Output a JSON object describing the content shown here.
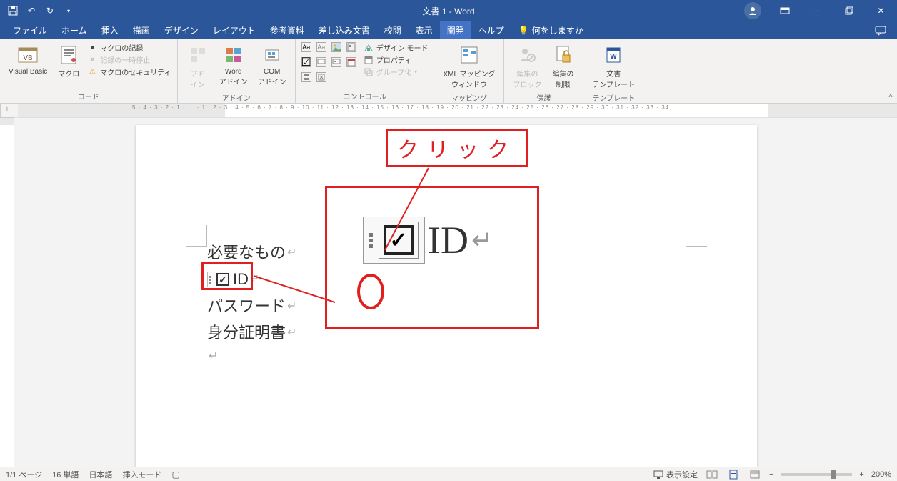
{
  "title": "文書 1 - Word",
  "qat": {
    "save": "💾",
    "undo": "↶",
    "redo": "↷",
    "customize": "▾"
  },
  "tabs": {
    "file": "ファイル",
    "home": "ホーム",
    "insert": "挿入",
    "draw": "描画",
    "design": "デザイン",
    "layout": "レイアウト",
    "references": "参考資料",
    "mailings": "差し込み文書",
    "review": "校閲",
    "view": "表示",
    "developer": "開発",
    "help": "ヘルプ"
  },
  "tell_me": "何をしますか",
  "ribbon": {
    "code": {
      "label": "コード",
      "vb": "Visual Basic",
      "macros": "マクロ",
      "record": "マクロの記録",
      "pause": "記録の一時停止",
      "security": "マクロのセキュリティ"
    },
    "addins": {
      "label": "アドイン",
      "addins": "アド\nイン",
      "word": "Word\nアドイン",
      "com": "COM\nアドイン"
    },
    "controls": {
      "label": "コントロール",
      "design": "デザイン モード",
      "properties": "プロパティ",
      "group": "グループ化"
    },
    "mapping": {
      "label": "マッピング",
      "xml": "XML マッピング\nウィンドウ"
    },
    "protect": {
      "label": "保護",
      "block": "編集の\nブロック",
      "restrict": "編集の\n制限"
    },
    "template": {
      "label": "テンプレート",
      "doc": "文書\nテンプレート"
    }
  },
  "document": {
    "line1": "必要なもの",
    "id_label": "ID",
    "line3": "パスワード",
    "line4": "身分証明書"
  },
  "annotation": {
    "click": "クリック",
    "zoom_id": "ID"
  },
  "status": {
    "page": "1/1 ページ",
    "words": "16 単語",
    "lang": "日本語",
    "mode": "挿入モード",
    "display": "表示設定",
    "zoom": "200%"
  }
}
